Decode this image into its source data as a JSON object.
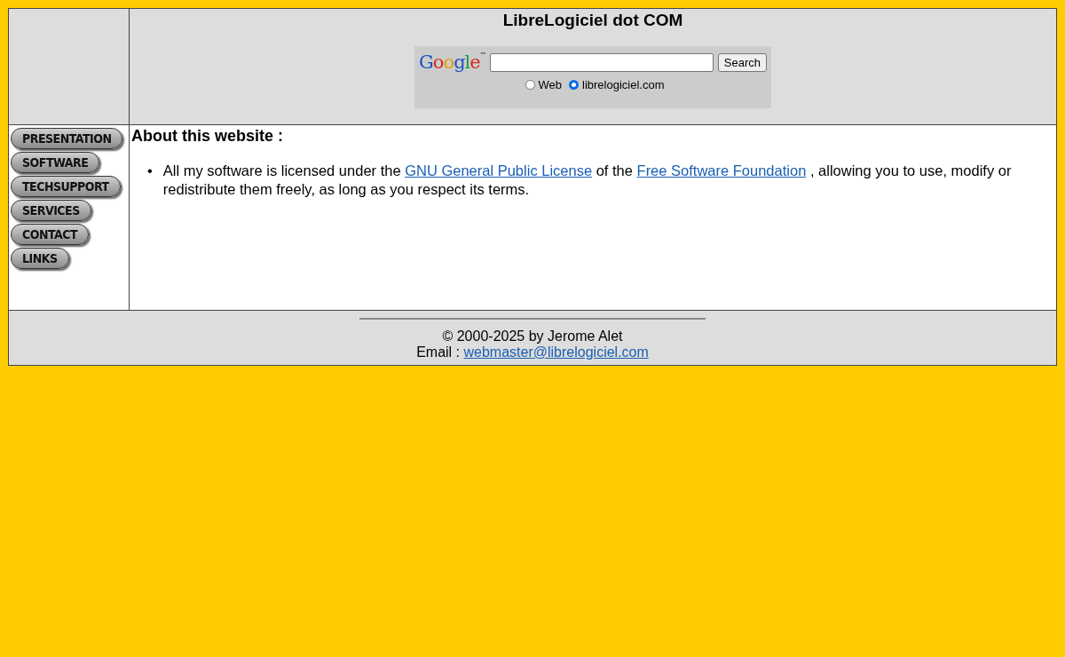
{
  "header": {
    "title": "LibreLogiciel dot COM",
    "search": {
      "logo": "Google",
      "logo_mark": "™",
      "button": "Search",
      "scopes": [
        {
          "label": "Web",
          "selected": false
        },
        {
          "label": "librelogiciel.com",
          "selected": true
        }
      ]
    }
  },
  "nav": [
    {
      "label": "PRESENTATION"
    },
    {
      "label": "SOFTWARE"
    },
    {
      "label": "TECHSUPPORT"
    },
    {
      "label": "SERVICES"
    },
    {
      "label": "CONTACT"
    },
    {
      "label": "LINKS"
    }
  ],
  "content": {
    "heading": "About this website :",
    "items": [
      {
        "bullet": "•",
        "parts": [
          {
            "kind": "text",
            "text": "All my software is licensed under the "
          },
          {
            "kind": "link",
            "text": "GNU General Public License"
          },
          {
            "kind": "text",
            "text": " of the "
          },
          {
            "kind": "link",
            "text": "Free Software Foundation"
          },
          {
            "kind": "text",
            "text": " , allowing you to use, modify or redistribute them freely, as long as you respect its terms."
          }
        ]
      }
    ]
  },
  "footer": {
    "copyright": "© 2000-2025 by Jerome Alet",
    "email_label": "Email :",
    "email": "webmaster@librelogiciel.com"
  }
}
